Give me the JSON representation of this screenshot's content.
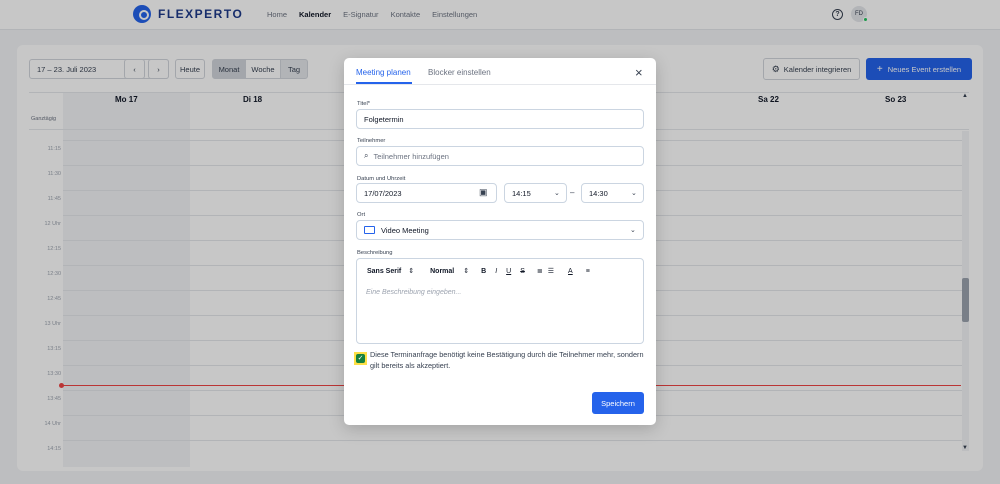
{
  "brand": {
    "name": "FLEXPERTO",
    "logo_icon": "pin-logo-icon"
  },
  "nav": {
    "items": [
      {
        "label": "Home",
        "active": false
      },
      {
        "label": "Kalender",
        "active": true
      },
      {
        "label": "E-Signatur",
        "active": false
      },
      {
        "label": "Kontakte",
        "active": false
      },
      {
        "label": "Einstellungen",
        "active": false
      }
    ],
    "help_icon": "?",
    "avatar": "FD",
    "avatar_status_color": "#22c55e"
  },
  "calendar": {
    "date_range": "17 – 23. Juli 2023",
    "prev": "‹",
    "next": "›",
    "today_label": "Heute",
    "views": [
      "Monat",
      "Woche",
      "Tag"
    ],
    "integrate_label": "Kalender integrieren",
    "new_event_label": "Neues Event erstellen",
    "days": [
      "Mo 17",
      "Di 18",
      "Sa 22",
      "So 23"
    ],
    "allday_label": "Ganztägig",
    "times": [
      "11:15",
      "11:30",
      "11:45",
      "12 Uhr",
      "12:15",
      "12:30",
      "12:45",
      "13 Uhr",
      "13:15",
      "13:30",
      "13:45",
      "14 Uhr",
      "14:15"
    ],
    "now_line_color": "#ef4444"
  },
  "modal": {
    "tabs": [
      "Meeting planen",
      "Blocker einstellen"
    ],
    "close": "×",
    "title_label": "Titel*",
    "title_value": "Folgetermin",
    "participants_label": "Teilnehmer",
    "participants_placeholder": "Teilnehmer hinzufügen",
    "datetime_label": "Datum und Uhrzeit",
    "date_value": "17/07/2023",
    "start_time": "14:15",
    "time_separator": "–",
    "end_time": "14:30",
    "location_label": "Ort",
    "location_value": "Video Meeting",
    "description_label": "Beschreibung",
    "editor": {
      "font": "Sans Serif",
      "size": "Normal",
      "bold": "B",
      "italic": "I",
      "underline": "U",
      "strike": "S",
      "placeholder": "Eine Beschreibung eingeben..."
    },
    "consent_checked": true,
    "consent_text": "Diese Terminanfrage benötigt keine Bestätigung durch die Teilnehmer mehr, sondern gilt bereits als akzeptiert.",
    "save_label": "Speichern",
    "accent_color": "#2563eb"
  }
}
